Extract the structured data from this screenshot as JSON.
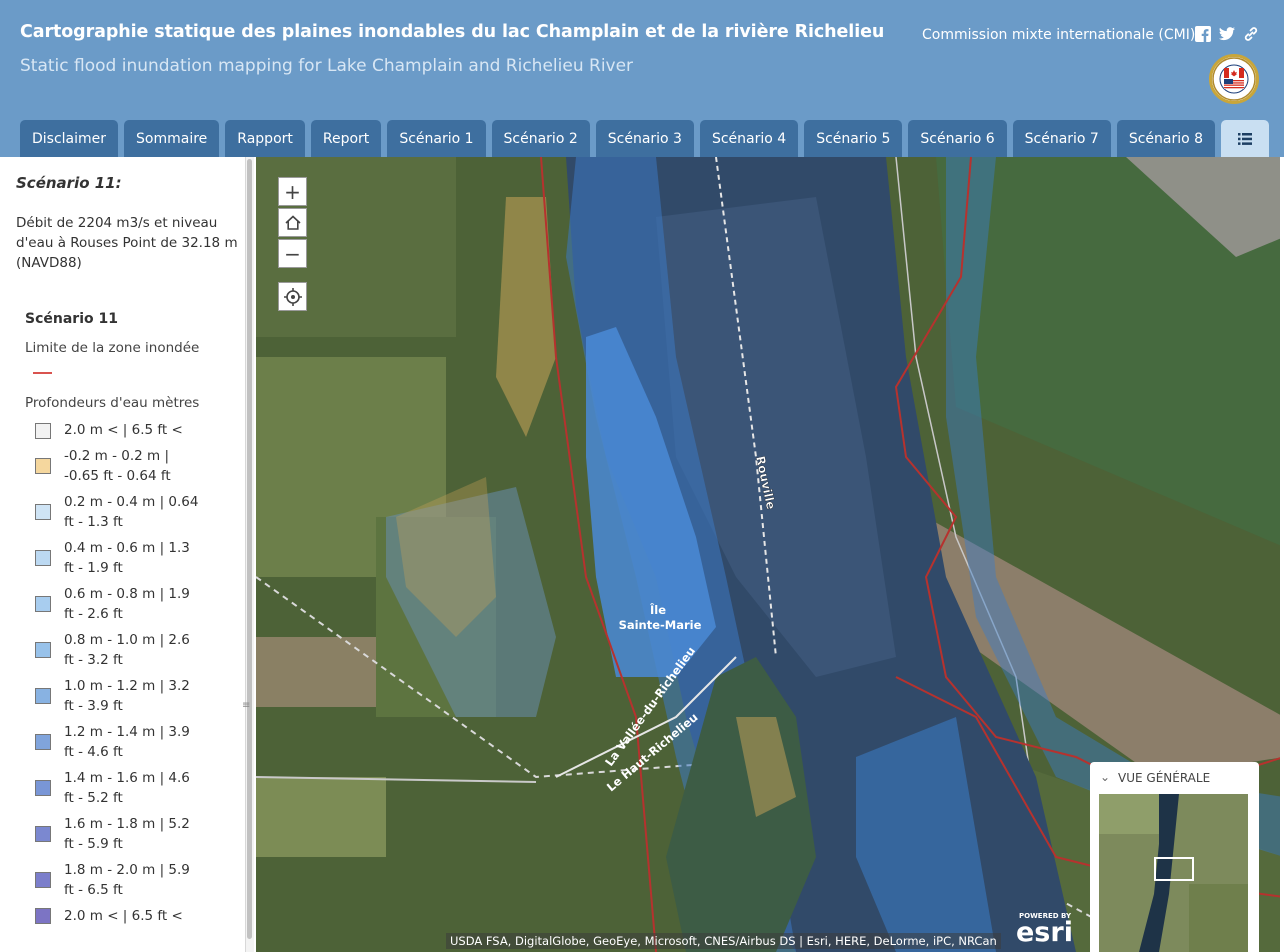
{
  "header": {
    "title": "Cartographie statique des plaines inondables du lac Champlain et de la rivière Richelieu",
    "subtitle": "Static flood inundation mapping for Lake Champlain and Richelieu River",
    "org": "Commission mixte internationale (CMI)"
  },
  "tabs": [
    {
      "label": "Disclaimer"
    },
    {
      "label": "Sommaire"
    },
    {
      "label": "Rapport"
    },
    {
      "label": "Report"
    },
    {
      "label": "Scénario 1"
    },
    {
      "label": "Scénario 2"
    },
    {
      "label": "Scénario 3"
    },
    {
      "label": "Scénario 4"
    },
    {
      "label": "Scénario 5"
    },
    {
      "label": "Scénario 6"
    },
    {
      "label": "Scénario 7"
    },
    {
      "label": "Scénario 8"
    }
  ],
  "sidebar": {
    "heading": "Scénario 11:",
    "description": "Débit de 2204 m3/s et niveau d'eau à Rouses Point de 32.18 m (NAVD88)",
    "legend": {
      "title": "Scénario 11",
      "limit_label": "Limite de la zone inondée",
      "depth_label": "Profondeurs d'eau mètres",
      "items": [
        {
          "label": "2.0 m < | 6.5 ft <",
          "color": "#f2f2f2"
        },
        {
          "label": "-0.2 m - 0.2 m | -0.65 ft - 0.64 ft",
          "color": "#f5d79e"
        },
        {
          "label": "0.2 m - 0.4 m | 0.64 ft - 1.3 ft",
          "color": "#cfe4f5"
        },
        {
          "label": "0.4 m - 0.6 m | 1.3 ft - 1.9 ft",
          "color": "#bcd9f2"
        },
        {
          "label": "0.6 m - 0.8 m | 1.9 ft - 2.6 ft",
          "color": "#a8cdef"
        },
        {
          "label": "0.8 m - 1.0 m | 2.6 ft - 3.2 ft",
          "color": "#98c2ea"
        },
        {
          "label": "1.0 m - 1.2 m | 3.2 ft - 3.9 ft",
          "color": "#88b2e2"
        },
        {
          "label": "1.2 m - 1.4 m | 3.9 ft - 4.6 ft",
          "color": "#80a4dc"
        },
        {
          "label": "1.4 m - 1.6 m | 4.6 ft - 5.2 ft",
          "color": "#7996d6"
        },
        {
          "label": "1.6 m - 1.8 m | 5.2 ft - 5.9 ft",
          "color": "#7b88d0"
        },
        {
          "label": "1.8 m - 2.0 m | 5.9 ft - 6.5 ft",
          "color": "#7b7ecb"
        },
        {
          "label": "2.0 m < | 6.5 ft <",
          "color": "#7c74c4"
        }
      ]
    }
  },
  "map": {
    "zoom_in": "+",
    "zoom_out": "−",
    "labels": {
      "rouville": "Rouville",
      "ile1": "Île",
      "ile2": "Sainte-Marie",
      "vallee": "La Vallée-du-Richelieu",
      "haut": "Le Haut-Richelieu"
    },
    "attribution": "USDA FSA, DigitalGlobe, GeoEye, Microsoft, CNES/Airbus DS | Esri, HERE, DeLorme, iPC, NRCan",
    "powered_by": "POWERED BY",
    "esri": "esri",
    "overview_title": "VUE GÉNÉRALE"
  }
}
